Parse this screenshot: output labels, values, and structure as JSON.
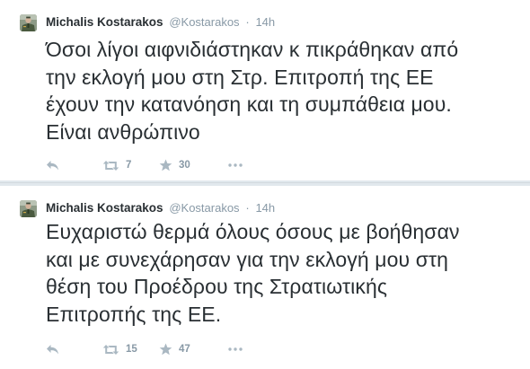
{
  "tweets": [
    {
      "author_name": "Michalis Kostarakos",
      "author_handle": "@Kostarakos",
      "separator": "·",
      "time": "14h",
      "text": "Όσοι λίγοι αιφνιδιάστηκαν κ πικράθηκαν από\nτην εκλογή μου στη Στρ. Επιτροπή της ΕΕ\nέχουν την κατανόηση και τη συμπάθεια μου.\nΕίναι ανθρώπινο",
      "retweets": "7",
      "favorites": "30",
      "icons": {
        "avatar": "avatar-photo",
        "reply": "reply-icon",
        "retweet": "retweet-icon",
        "favorite": "star-icon",
        "more": "more-dots-icon"
      }
    },
    {
      "author_name": "Michalis Kostarakos",
      "author_handle": "@Kostarakos",
      "separator": "·",
      "time": "14h",
      "text": "Ευχαριστώ θερμά όλους όσους με βοήθησαν\nκαι με συνεχάρησαν για την εκλογή μου στη\nθέση του Προέδρου της Στρατιωτικής\nΕπιτροπής της ΕΕ.",
      "retweets": "15",
      "favorites": "47",
      "icons": {
        "avatar": "avatar-photo",
        "reply": "reply-icon",
        "retweet": "retweet-icon",
        "favorite": "star-icon",
        "more": "more-dots-icon"
      }
    }
  ],
  "colors": {
    "text": "#292f33",
    "muted": "#8899a6",
    "icon": "#aab8c2",
    "separator": "#e1e8ed"
  }
}
